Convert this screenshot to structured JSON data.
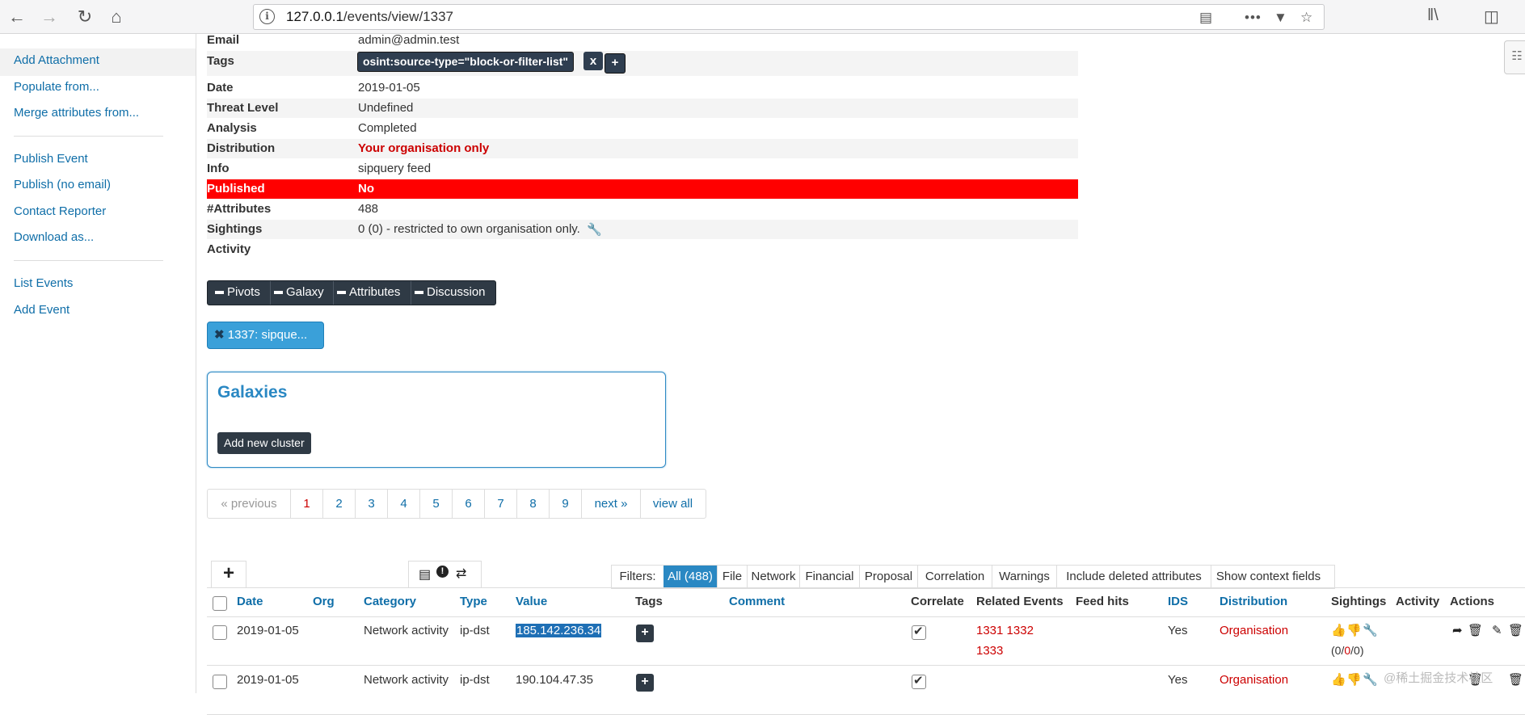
{
  "browser": {
    "url_host": "127.0.0.1",
    "url_path": "/events/view/1337"
  },
  "sidebar": {
    "items": [
      {
        "label": "Add Attachment"
      },
      {
        "label": "Populate from..."
      },
      {
        "label": "Merge attributes from..."
      },
      {
        "label": "Publish Event"
      },
      {
        "label": "Publish (no email)"
      },
      {
        "label": "Contact Reporter"
      },
      {
        "label": "Download as..."
      },
      {
        "label": "List Events"
      },
      {
        "label": "Add Event"
      }
    ]
  },
  "details": {
    "email": {
      "key": "Email",
      "value": "admin@admin.test"
    },
    "tags": {
      "key": "Tags",
      "tag": "osint:source-type=\"block-or-filter-list\"",
      "remove": "x",
      "add": "+"
    },
    "date": {
      "key": "Date",
      "value": "2019-01-05"
    },
    "threat": {
      "key": "Threat Level",
      "value": "Undefined"
    },
    "analysis": {
      "key": "Analysis",
      "value": "Completed"
    },
    "distribution": {
      "key": "Distribution",
      "value": "Your organisation only"
    },
    "info": {
      "key": "Info",
      "value": "sipquery feed"
    },
    "published": {
      "key": "Published",
      "value": "No"
    },
    "attributes": {
      "key": "#Attributes",
      "value": "488"
    },
    "sightings": {
      "key": "Sightings",
      "value": "0 (0) - restricted to own organisation only."
    },
    "activity": {
      "key": "Activity",
      "value": ""
    }
  },
  "toggles": [
    "Pivots",
    "Galaxy",
    "Attributes",
    "Discussion"
  ],
  "event_chip": "1337: sipque...",
  "galaxies": {
    "title": "Galaxies",
    "button": "Add new cluster"
  },
  "pagination": [
    "« previous",
    "1",
    "2",
    "3",
    "4",
    "5",
    "6",
    "7",
    "8",
    "9",
    "next »",
    "view all"
  ],
  "filters": {
    "label": "Filters:",
    "items": [
      "All (488)",
      "File",
      "Network",
      "Financial",
      "Proposal",
      "Correlation",
      "Warnings",
      "Include deleted attributes",
      "Show context fields"
    ]
  },
  "table": {
    "headers": [
      "Date",
      "Org",
      "Category",
      "Type",
      "Value",
      "Tags",
      "Comment",
      "Correlate",
      "Related Events",
      "Feed hits",
      "IDS",
      "Distribution",
      "Sightings",
      "Activity",
      "Actions"
    ],
    "rows": [
      {
        "date": "2019-01-05",
        "category": "Network activity",
        "type": "ip-dst",
        "value": "185.142.236.34",
        "related1": "1331 1332",
        "related2": "1333",
        "ids": "Yes",
        "distribution": "Organisation",
        "sight_open": "(",
        "sight_a": "0",
        "sight_b": "0",
        "sight_c": "0",
        "sight_close": ")",
        "sight_sep": "/"
      },
      {
        "date": "2019-01-05",
        "category": "Network activity",
        "type": "ip-dst",
        "value": "190.104.47.35",
        "related1": "",
        "related2": "",
        "ids": "Yes",
        "distribution": "Organisation"
      }
    ]
  },
  "watermark": "@稀土掘金技术社区",
  "colors": {
    "link": "#0f6ea8",
    "danger": "#ff0000",
    "dark": "#2f3a45",
    "accent": "#2a88c3"
  }
}
